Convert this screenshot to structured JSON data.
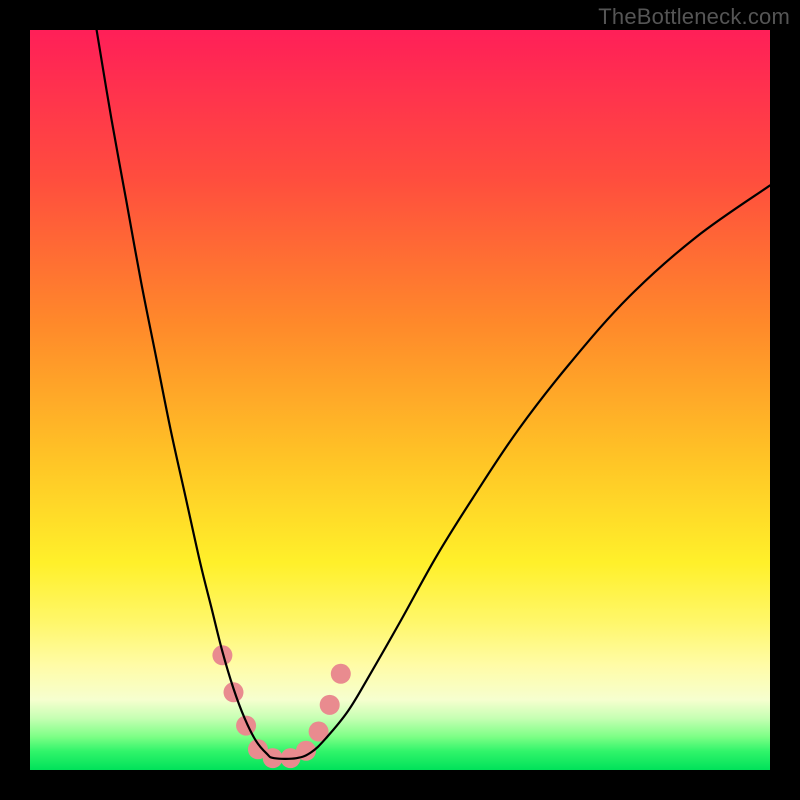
{
  "watermark": "TheBottleneck.com",
  "chart_data": {
    "type": "line",
    "title": "",
    "xlabel": "",
    "ylabel": "",
    "xlim": [
      0,
      100
    ],
    "ylim": [
      0,
      100
    ],
    "background_gradient_stops": [
      {
        "offset": 0.0,
        "color": "#ff1f58"
      },
      {
        "offset": 0.2,
        "color": "#ff4d3e"
      },
      {
        "offset": 0.4,
        "color": "#ff8a2a"
      },
      {
        "offset": 0.58,
        "color": "#ffc426"
      },
      {
        "offset": 0.72,
        "color": "#fff02a"
      },
      {
        "offset": 0.8,
        "color": "#fff76a"
      },
      {
        "offset": 0.86,
        "color": "#fffca8"
      },
      {
        "offset": 0.905,
        "color": "#f6ffcf"
      },
      {
        "offset": 0.93,
        "color": "#c6ffb3"
      },
      {
        "offset": 0.955,
        "color": "#7dff86"
      },
      {
        "offset": 0.975,
        "color": "#30f46a"
      },
      {
        "offset": 1.0,
        "color": "#00e25a"
      }
    ],
    "series": [
      {
        "name": "bottleneck-curve",
        "stroke": "#000000",
        "stroke_width": 2.2,
        "x": [
          9,
          11,
          13,
          15,
          17,
          19,
          21,
          23,
          24.5,
          26,
          27.5,
          29,
          30.5,
          32,
          33,
          36,
          38,
          40,
          43,
          46,
          50,
          55,
          60,
          66,
          73,
          81,
          90,
          100
        ],
        "y": [
          100,
          88,
          77,
          66,
          56,
          46,
          37,
          28,
          22,
          16,
          11,
          7,
          4,
          2.2,
          1.6,
          1.6,
          2.4,
          4.3,
          8,
          13,
          20,
          29,
          37,
          46,
          55,
          64,
          72,
          79
        ]
      }
    ],
    "markers": {
      "name": "highlight-band",
      "color": "#e98b8f",
      "radius": 10,
      "points": [
        {
          "x": 26.0,
          "y": 15.5
        },
        {
          "x": 27.5,
          "y": 10.5
        },
        {
          "x": 29.2,
          "y": 6.0
        },
        {
          "x": 30.8,
          "y": 2.8
        },
        {
          "x": 32.8,
          "y": 1.6
        },
        {
          "x": 35.2,
          "y": 1.6
        },
        {
          "x": 37.3,
          "y": 2.6
        },
        {
          "x": 39.0,
          "y": 5.2
        },
        {
          "x": 40.5,
          "y": 8.8
        },
        {
          "x": 42.0,
          "y": 13.0
        }
      ]
    }
  }
}
